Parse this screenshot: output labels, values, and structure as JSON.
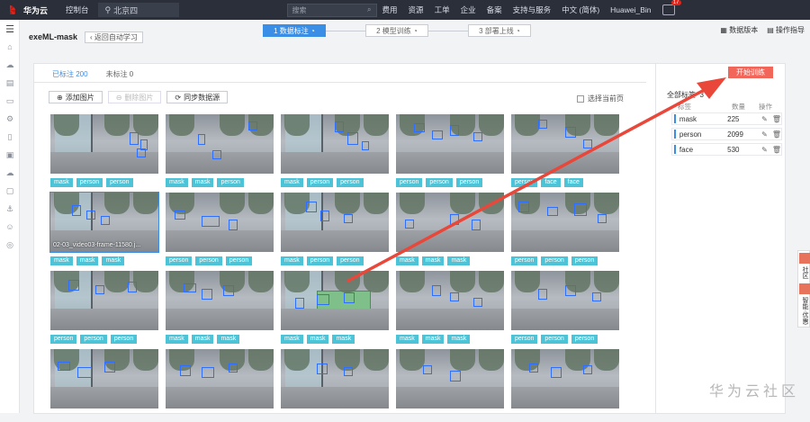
{
  "topbar": {
    "brand": "华为云",
    "console": "控制台",
    "region": "北京四",
    "search_placeholder": "搜索",
    "items": [
      "费用",
      "资源",
      "工单",
      "企业",
      "备案",
      "支持与服务",
      "中文 (简体)",
      "Huawei_Bin"
    ],
    "notice_count": "17"
  },
  "header": {
    "title": "exeML-mask",
    "back": "返回自动学习",
    "steps": [
      "1 数据标注",
      "2 模型训练",
      "3 部署上线"
    ],
    "right": [
      "数据版本",
      "操作指导"
    ]
  },
  "tabs": [
    "已标注 200",
    "未标注 0"
  ],
  "toolbar": {
    "add": "添加图片",
    "delete": "删除图片",
    "sync": "同步数据源",
    "select_page": "选择当前页"
  },
  "grid": {
    "cells": [
      {
        "tags": [
          "mask",
          "person",
          "person"
        ],
        "caption": ""
      },
      {
        "tags": [
          "mask",
          "mask",
          "person"
        ],
        "caption": ""
      },
      {
        "tags": [
          "mask",
          "person",
          "person"
        ],
        "caption": ""
      },
      {
        "tags": [
          "person",
          "person",
          "person"
        ],
        "caption": ""
      },
      {
        "tags": [
          "person",
          "face",
          "face"
        ],
        "caption": ""
      },
      {
        "tags": [
          "mask",
          "mask",
          "mask"
        ],
        "caption": "02-03_video03-frame-11580.j..."
      },
      {
        "tags": [
          "person",
          "person",
          "person"
        ],
        "caption": ""
      },
      {
        "tags": [
          "mask",
          "person",
          "person"
        ],
        "caption": ""
      },
      {
        "tags": [
          "mask",
          "mask",
          "mask"
        ],
        "caption": ""
      },
      {
        "tags": [
          "person",
          "person",
          "person"
        ],
        "caption": ""
      },
      {
        "tags": [
          "person",
          "person",
          "person"
        ],
        "caption": ""
      },
      {
        "tags": [
          "mask",
          "mask",
          "mask"
        ],
        "caption": ""
      },
      {
        "tags": [
          "mask",
          "mask",
          "mask"
        ],
        "caption": ""
      },
      {
        "tags": [
          "mask",
          "mask",
          "mask"
        ],
        "caption": ""
      },
      {
        "tags": [
          "person",
          "person",
          "person"
        ],
        "caption": ""
      },
      {
        "tags": [],
        "caption": ""
      },
      {
        "tags": [],
        "caption": ""
      },
      {
        "tags": [],
        "caption": ""
      },
      {
        "tags": [],
        "caption": ""
      },
      {
        "tags": [],
        "caption": ""
      }
    ]
  },
  "labels": {
    "start_training": "开始训练",
    "title": "全部标签",
    "count": "3",
    "col_name": "标签",
    "col_count": "数量",
    "col_ops": "操作",
    "rows": [
      {
        "name": "mask",
        "count": "225"
      },
      {
        "name": "person",
        "count": "2099"
      },
      {
        "name": "face",
        "count": "530"
      }
    ]
  },
  "float_right": [
    "社区",
    "智能·优惠"
  ],
  "watermark": "华为云社区",
  "colors": {
    "accent": "#3a8ee6",
    "tag": "#4cc3d6",
    "start": "#f2665a",
    "arrow": "#e8473a"
  }
}
